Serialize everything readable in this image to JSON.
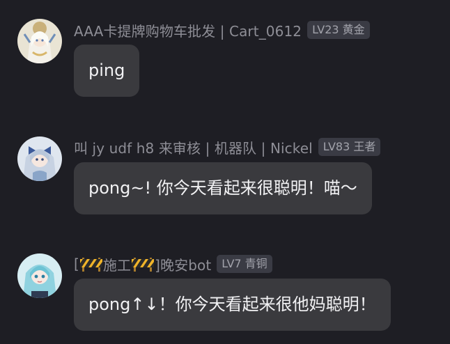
{
  "messages": [
    {
      "sender": "AAA卡提牌购物车批发 | Cart_0612",
      "level_badge": "LV23 黄金",
      "text": "ping",
      "avatar_icon": "anime-girl-white-hair-avatar-icon"
    },
    {
      "sender": "叫 jy udf h8 来审核 | 机器队 | Nickel",
      "level_badge": "LV83 王者",
      "text": "pong~! 你今天看起来很聪明！喵～",
      "avatar_icon": "anime-girl-blue-bow-avatar-icon"
    },
    {
      "sender_prefix": "[",
      "sender_middle": "施工",
      "sender_suffix": "]晚安bot",
      "sender_icons": [
        "construction-barrier-icon",
        "construction-barrier-icon"
      ],
      "level_badge": "LV7 青铜",
      "text": "pong↑↓！你今天看起来很他妈聪明！",
      "avatar_icon": "anime-girl-teal-hair-avatar-icon"
    }
  ],
  "colors": {
    "background": "#1e1e24",
    "bubble": "#3a3a3e",
    "nickname": "#8e8e96",
    "badge_bg": "#3a3b44",
    "text": "#f2f2f4"
  }
}
